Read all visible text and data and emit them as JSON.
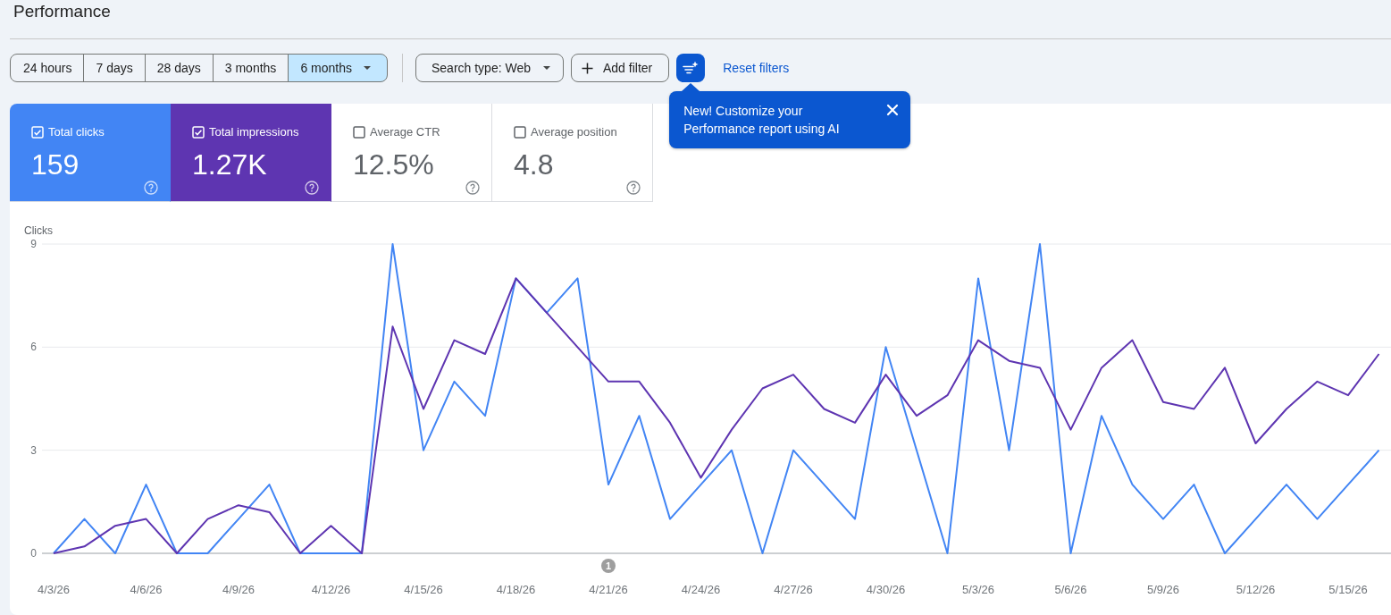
{
  "page": {
    "title": "Performance"
  },
  "time_ranges": [
    {
      "label": "24 hours",
      "selected": false,
      "kind": "option"
    },
    {
      "label": "7 days",
      "selected": false,
      "kind": "option"
    },
    {
      "label": "28 days",
      "selected": false,
      "kind": "option"
    },
    {
      "label": "3 months",
      "selected": false,
      "kind": "option"
    },
    {
      "label": "6 months",
      "selected": true,
      "kind": "dropdown"
    }
  ],
  "filters": {
    "search_type_button": "Search type: Web",
    "add_filter_button": "Add filter",
    "reset_link": "Reset filters"
  },
  "ai_tooltip": {
    "text": "New! Customize your Performance report using AI"
  },
  "metric_cards": [
    {
      "label": "Total clicks",
      "value": "159",
      "checked": true,
      "color": "#4285f4"
    },
    {
      "label": "Total impressions",
      "value": "1.27K",
      "checked": true,
      "color": "#5e35b1"
    },
    {
      "label": "Average CTR",
      "value": "12.5%",
      "checked": false
    },
    {
      "label": "Average position",
      "value": "4.8",
      "checked": false
    }
  ],
  "chart": {
    "chart_data": {
      "type": "line",
      "ylabel": "Clicks",
      "categories": [
        "4/3/26",
        null,
        null,
        "4/6/26",
        null,
        null,
        "4/9/26",
        null,
        null,
        "4/12/26",
        null,
        null,
        "4/15/26",
        null,
        null,
        "4/18/26",
        null,
        null,
        "4/21/26",
        null,
        null,
        "4/24/26",
        null,
        null,
        "4/27/26",
        null,
        null,
        "4/30/26",
        null,
        null,
        "5/3/26",
        null,
        null,
        "5/6/26",
        null,
        null,
        "5/9/26",
        null,
        null,
        "5/12/26",
        null,
        null,
        "5/15/26",
        null
      ],
      "series": [
        {
          "color": "#4285f4",
          "values": [
            0,
            1,
            0,
            2,
            0,
            0,
            1,
            2,
            0,
            0,
            0,
            9,
            3,
            5,
            4,
            8,
            7,
            8,
            2,
            4,
            1,
            2,
            3,
            0,
            3,
            2,
            1,
            6,
            3,
            0,
            8,
            3,
            9,
            0,
            4,
            2,
            1,
            2,
            0,
            1,
            2,
            1,
            2,
            3
          ]
        },
        {
          "color": "#5e35b1",
          "values": [
            0,
            0.2,
            0.8,
            1,
            0,
            1,
            1.4,
            1.2,
            0,
            0.8,
            0,
            6.6,
            4.2,
            6.2,
            5.8,
            8,
            7,
            6,
            5,
            5,
            3.8,
            2.2,
            3.6,
            4.8,
            5.2,
            4.2,
            3.8,
            5.2,
            4,
            4.6,
            6.2,
            5.6,
            5.4,
            3.6,
            5.4,
            6.2,
            4.4,
            4.2,
            5.4,
            3.2,
            4.2,
            5,
            4.6,
            5.8
          ]
        }
      ],
      "ylim": [
        0,
        9
      ],
      "yticks": [
        0,
        3,
        6,
        9
      ],
      "annotations": [
        "1"
      ]
    }
  }
}
